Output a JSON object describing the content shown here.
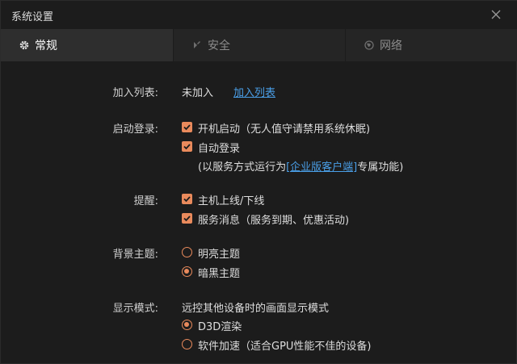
{
  "window": {
    "title": "系统设置"
  },
  "tabs": [
    {
      "label": "常规",
      "icon": "gear-icon",
      "active": true
    },
    {
      "label": "安全",
      "icon": "shield-icon",
      "active": false
    },
    {
      "label": "网络",
      "icon": "globe-icon",
      "active": false
    }
  ],
  "colors": {
    "accent": "#e98a5c",
    "link": "#4a9fe8"
  },
  "join_list": {
    "label": "加入列表:",
    "status": "未加入",
    "link": "加入列表"
  },
  "startup_login": {
    "label": "启动登录:",
    "boot_start": {
      "label": "开机启动（无人值守请禁用系统休眠)",
      "checked": true
    },
    "auto_login": {
      "label": "自动登录",
      "checked": true
    },
    "note_prefix": "(以服务方式运行为",
    "note_link": "[企业版客户端]",
    "note_suffix": "专属功能)"
  },
  "reminders": {
    "label": "提醒:",
    "host_online": {
      "label": "主机上线/下线",
      "checked": true
    },
    "service_msg": {
      "label": "服务消息（服务到期、优惠活动)",
      "checked": true
    }
  },
  "theme": {
    "label": "背景主题:",
    "light": {
      "label": "明亮主题",
      "selected": false
    },
    "dark": {
      "label": "暗黑主题",
      "selected": true
    }
  },
  "display_mode": {
    "label": "显示模式:",
    "description": "远控其他设备时的画面显示模式",
    "d3d": {
      "label": "D3D渲染",
      "selected": true
    },
    "software": {
      "label": "软件加速（适合GPU性能不佳的设备)",
      "selected": false
    }
  }
}
